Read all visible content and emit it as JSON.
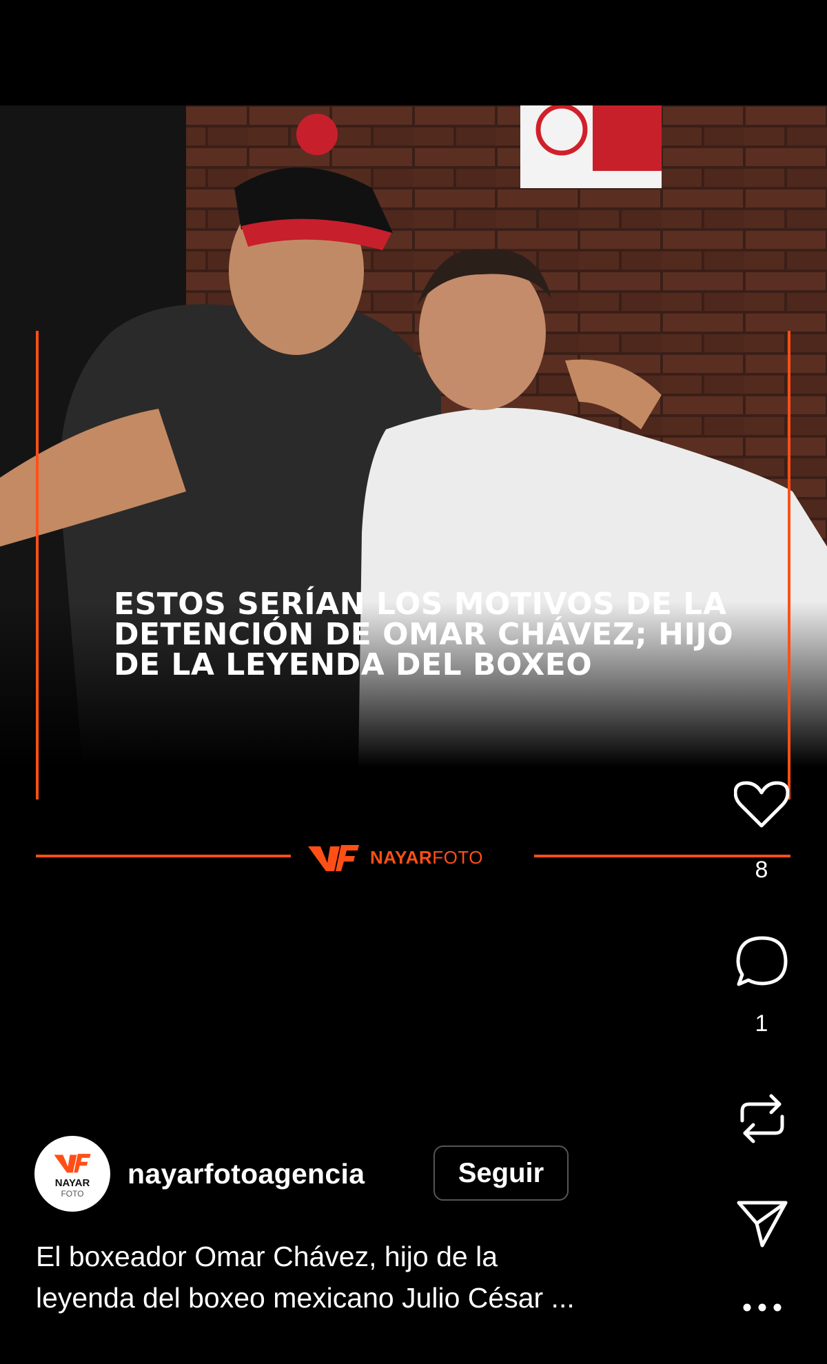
{
  "post": {
    "headline_lines": [
      "ESTOS SERÍAN LOS MOTIVOS DE LA",
      "DETENCIÓN DE OMAR CHÁVEZ; HIJO",
      "DE LA LEYENDA DEL BOXEO"
    ],
    "brand": {
      "bold": "NAYAR",
      "light": "FOTO"
    },
    "colors": {
      "accent": "#ff4f17"
    }
  },
  "actions": {
    "like": {
      "icon": "heart-icon",
      "count": "8"
    },
    "comment": {
      "icon": "comment-icon",
      "count": "1"
    },
    "repost": {
      "icon": "repost-icon"
    },
    "share": {
      "icon": "send-icon"
    },
    "more": {
      "icon": "more-icon",
      "label": "..."
    }
  },
  "author": {
    "avatar_text": "NAYAR",
    "avatar_subtext": "FOTO",
    "username": "nayarfotoagencia",
    "follow_label": "Seguir"
  },
  "caption_lines": [
    "El boxeador Omar Chávez, hijo de la",
    "leyenda del boxeo mexicano Julio César ..."
  ]
}
